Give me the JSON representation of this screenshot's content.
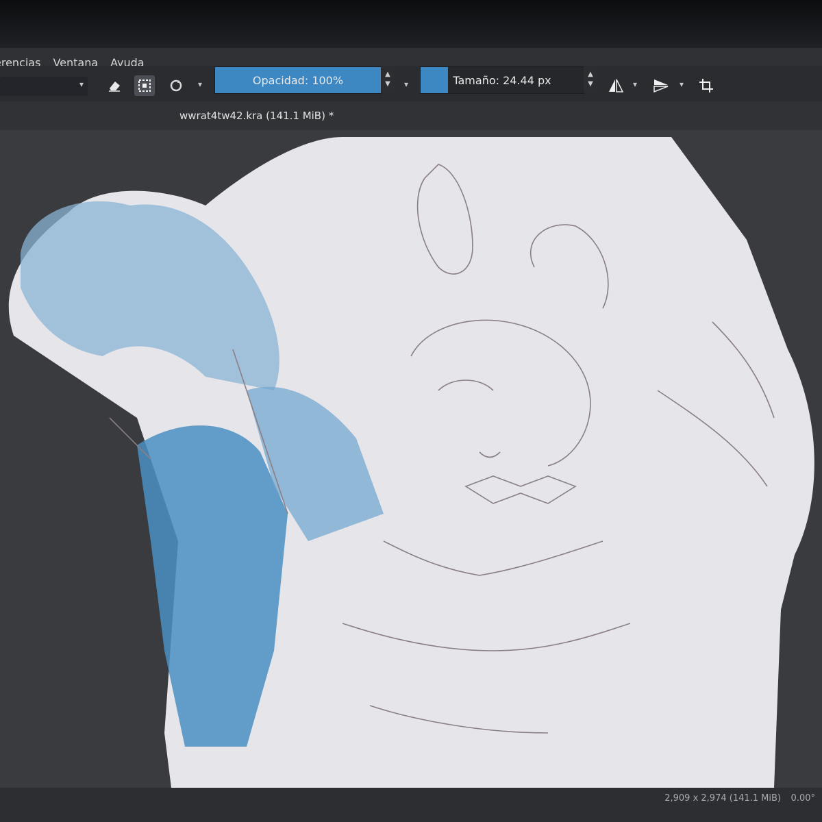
{
  "menu": {
    "items": [
      "erencias",
      "Ventana",
      "Ayuda"
    ]
  },
  "toolbar": {
    "opacity_label": "Opacidad: 100%",
    "opacity_fraction": 1.0,
    "size_label": "Tamaño: 24.44 px",
    "size_fraction": 0.17
  },
  "document": {
    "tab_title": "wwrat4tw42.kra (141.1 MiB) *"
  },
  "status": {
    "canvas_size": "2,909 x 2,974 (141.1 MiB)",
    "rotation": "0.00°"
  },
  "colors": {
    "accent": "#3d87c3",
    "canvas_paper": "#e6e6ea",
    "shade_blue": "#4a90c2",
    "sketch_line": "#8a7f86"
  },
  "icons": [
    "eraser-icon",
    "preserve-alpha-icon",
    "reload-preset-icon",
    "mirror-horizontal-icon",
    "mirror-vertical-icon",
    "wrap-around-icon"
  ]
}
